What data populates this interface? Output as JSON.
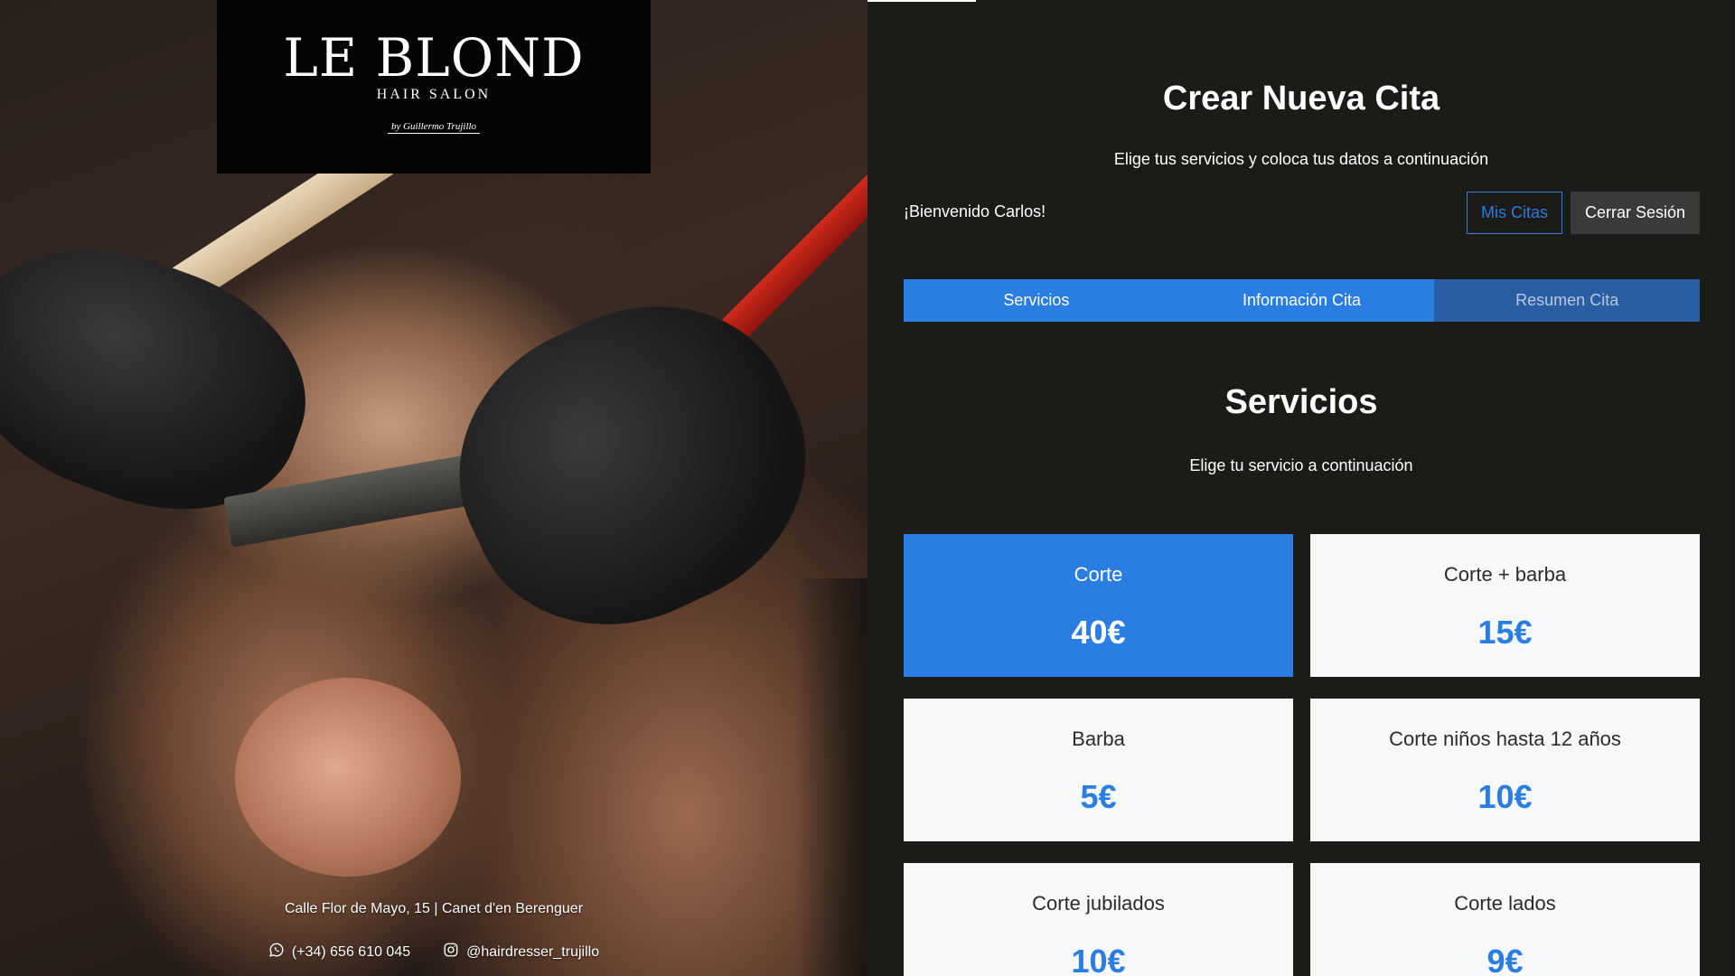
{
  "brand": {
    "name": "LE BLOND",
    "tagline": "HAIR SALON",
    "signature": "by Guillermo Trujillo"
  },
  "contact": {
    "address": "Calle Flor de Mayo, 15 | Canet d'en Berenguer",
    "phone": "(+34) 656 610 045",
    "instagram": "@hairdresser_trujillo",
    "phone_icon": "whatsapp-icon",
    "instagram_icon": "instagram-icon"
  },
  "header": {
    "title": "Crear Nueva Cita",
    "subtitle": "Elige tus servicios y coloca tus datos a continuación",
    "welcome": "¡Bienvenido Carlos!",
    "my_appointments_label": "Mis Citas",
    "logout_label": "Cerrar Sesión"
  },
  "tabs": [
    {
      "label": "Servicios",
      "active": true
    },
    {
      "label": "Información Cita",
      "active": false
    },
    {
      "label": "Resumen Cita",
      "active": false,
      "disabled": true
    }
  ],
  "section": {
    "title": "Servicios",
    "subtitle": "Elige tu servicio a continuación"
  },
  "services": [
    {
      "name": "Corte",
      "price": "40€",
      "selected": true
    },
    {
      "name": "Corte + barba",
      "price": "15€",
      "selected": false
    },
    {
      "name": "Barba",
      "price": "5€",
      "selected": false
    },
    {
      "name": "Corte niños hasta 12 años",
      "price": "10€",
      "selected": false
    },
    {
      "name": "Corte jubilados",
      "price": "10€",
      "selected": false
    },
    {
      "name": "Corte lados",
      "price": "9€",
      "selected": false
    }
  ],
  "colors": {
    "accent": "#2a7de1",
    "background": "#1b1b18",
    "card": "#f7f8fa"
  }
}
